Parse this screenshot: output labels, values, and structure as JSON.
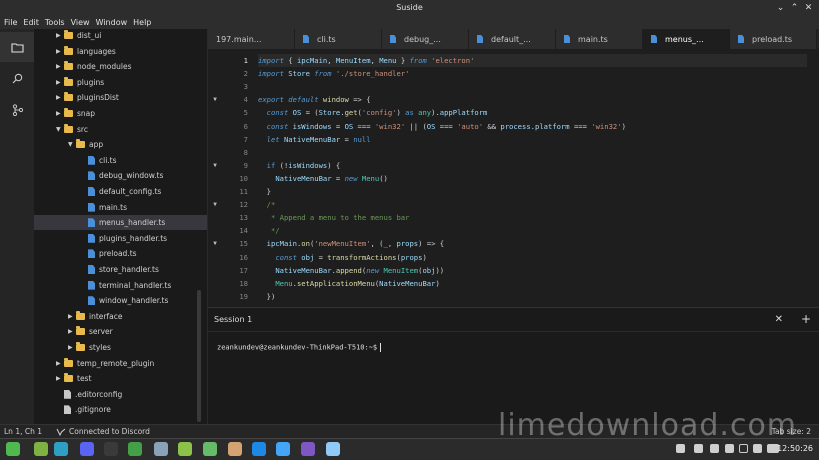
{
  "window": {
    "title": "Suside"
  },
  "menu": [
    "File",
    "Edit",
    "Tools",
    "View",
    "Window",
    "Help"
  ],
  "sidebar": {
    "items": [
      {
        "label": "dist_ui",
        "type": "folder",
        "depth": 1,
        "expanded": false
      },
      {
        "label": "languages",
        "type": "folder",
        "depth": 1,
        "expanded": false
      },
      {
        "label": "node_modules",
        "type": "folder",
        "depth": 1,
        "expanded": false
      },
      {
        "label": "plugins",
        "type": "folder",
        "depth": 1,
        "expanded": false
      },
      {
        "label": "pluginsDist",
        "type": "folder",
        "depth": 1,
        "expanded": false
      },
      {
        "label": "snap",
        "type": "folder",
        "depth": 1,
        "expanded": false
      },
      {
        "label": "src",
        "type": "folder",
        "depth": 1,
        "expanded": true
      },
      {
        "label": "app",
        "type": "folder",
        "depth": 2,
        "expanded": true
      },
      {
        "label": "cli.ts",
        "type": "ts",
        "depth": 3
      },
      {
        "label": "debug_window.ts",
        "type": "ts",
        "depth": 3
      },
      {
        "label": "default_config.ts",
        "type": "ts",
        "depth": 3
      },
      {
        "label": "main.ts",
        "type": "ts",
        "depth": 3
      },
      {
        "label": "menus_handler.ts",
        "type": "ts",
        "depth": 3,
        "selected": true
      },
      {
        "label": "plugins_handler.ts",
        "type": "ts",
        "depth": 3
      },
      {
        "label": "preload.ts",
        "type": "ts",
        "depth": 3
      },
      {
        "label": "store_handler.ts",
        "type": "ts",
        "depth": 3
      },
      {
        "label": "terminal_handler.ts",
        "type": "ts",
        "depth": 3
      },
      {
        "label": "window_handler.ts",
        "type": "ts",
        "depth": 3
      },
      {
        "label": "interface",
        "type": "folder",
        "depth": 2,
        "expanded": false
      },
      {
        "label": "server",
        "type": "folder",
        "depth": 2,
        "expanded": false
      },
      {
        "label": "styles",
        "type": "folder",
        "depth": 2,
        "expanded": false
      },
      {
        "label": "temp_remote_plugin",
        "type": "folder",
        "depth": 1,
        "expanded": false
      },
      {
        "label": "test",
        "type": "folder",
        "depth": 1,
        "expanded": false
      },
      {
        "label": ".editorconfig",
        "type": "file",
        "depth": 1
      },
      {
        "label": ".gitignore",
        "type": "file",
        "depth": 1
      }
    ]
  },
  "tabs": [
    {
      "label": "197.main...",
      "icon": false,
      "active": false
    },
    {
      "label": "cli.ts",
      "icon": true,
      "active": false
    },
    {
      "label": "debug_...",
      "icon": true,
      "active": false
    },
    {
      "label": "default_...",
      "icon": true,
      "active": false
    },
    {
      "label": "main.ts",
      "icon": true,
      "active": false
    },
    {
      "label": "menus_...",
      "icon": true,
      "active": true
    },
    {
      "label": "preload.ts",
      "icon": true,
      "active": false
    }
  ],
  "editor": {
    "lines": [
      {
        "n": "1",
        "fold": "",
        "html": "<span class='kw it'>import</span> { <span class='var'>ipcMain</span>, <span class='var'>MenuItem</span>, <span class='var'>Menu</span> } <span class='kw it'>from</span> <span class='str'>'electron'</span>"
      },
      {
        "n": "2",
        "fold": "",
        "html": "<span class='kw it'>import</span> <span class='var'>Store</span> <span class='kw it'>from</span> <span class='str'>'./store_handler'</span>"
      },
      {
        "n": "3",
        "fold": "",
        "html": ""
      },
      {
        "n": "4",
        "fold": "▼",
        "html": "<span class='kw it'>export default</span> <span class='fn'>window</span> <span class='op'>=&gt;</span> {"
      },
      {
        "n": "5",
        "fold": "",
        "html": "  <span class='kw it'>const</span> <span class='var'>OS</span> = (<span class='var'>Store</span>.<span class='fn'>get</span>(<span class='str'>'config'</span>) <span class='kw'>as</span> <span class='cls'>any</span>).<span class='var'>appPlatform</span>"
      },
      {
        "n": "6",
        "fold": "",
        "html": "  <span class='kw it'>const</span> <span class='var'>isWindows</span> = <span class='var'>OS</span> === <span class='str'>'win32'</span> || (<span class='var'>OS</span> === <span class='str'>'auto'</span> &amp;&amp; <span class='var'>process</span>.<span class='var'>platform</span> === <span class='str'>'win32'</span>)"
      },
      {
        "n": "7",
        "fold": "",
        "html": "  <span class='kw it'>let</span> <span class='var'>NativeMenuBar</span> = <span class='kw'>null</span>"
      },
      {
        "n": "8",
        "fold": "",
        "html": ""
      },
      {
        "n": "9",
        "fold": "▼",
        "html": "  <span class='kw'>if</span> (!<span class='var'>isWindows</span>) {"
      },
      {
        "n": "10",
        "fold": "",
        "html": "    <span class='var'>NativeMenuBar</span> = <span class='kw it'>new</span> <span class='cls'>Menu</span>()"
      },
      {
        "n": "11",
        "fold": "",
        "html": "  }"
      },
      {
        "n": "12",
        "fold": "▼",
        "html": "  <span class='cm'>/*</span>"
      },
      {
        "n": "13",
        "fold": "",
        "html": "   <span class='cm'>* Append a menu to the menus bar</span>"
      },
      {
        "n": "14",
        "fold": "",
        "html": "   <span class='cm'>*/</span>"
      },
      {
        "n": "15",
        "fold": "▼",
        "html": "  <span class='var'>ipcMain</span>.<span class='fn'>on</span>(<span class='str'>'newMenuItem'</span>, (<span class='var'>_</span>, <span class='var'>props</span>) <span class='op'>=&gt;</span> {"
      },
      {
        "n": "16",
        "fold": "",
        "html": "    <span class='kw it'>const</span> <span class='var'>obj</span> = <span class='fn'>transformActions</span>(<span class='var'>props</span>)"
      },
      {
        "n": "17",
        "fold": "",
        "html": "    <span class='var'>NativeMenuBar</span>.<span class='fn'>append</span>(<span class='kw it'>new</span> <span class='cls'>MenuItem</span>(<span class='var'>obj</span>))"
      },
      {
        "n": "18",
        "fold": "",
        "html": "    <span class='cls'>Menu</span>.<span class='fn'>setApplicationMenu</span>(<span class='var'>NativeMenuBar</span>)"
      },
      {
        "n": "19",
        "fold": "",
        "html": "  })"
      }
    ]
  },
  "terminal": {
    "tab_label": "Session 1",
    "close_glyph": "✕",
    "new_glyph": "+",
    "prompt": "zeankundev@zeankundev-ThinkPad-T510:~$"
  },
  "status": {
    "position": "Ln 1, Ch 1",
    "discord": "Connected to Discord",
    "tab_size": "Tab size: 2"
  },
  "watermark": "limedownload.com",
  "taskbar": {
    "clock": "12:50:26",
    "apps": [
      {
        "name": "mint-menu-icon",
        "color": "#4fb84f"
      },
      {
        "name": "files-icon",
        "color": "#7cb342"
      },
      {
        "name": "edge-icon",
        "color": "#2fa0c4"
      },
      {
        "name": "discord-icon",
        "color": "#5865f2"
      },
      {
        "name": "terminal-icon",
        "color": "#3a3a3a"
      },
      {
        "name": "app-green-icon",
        "color": "#43a047"
      },
      {
        "name": "suside-icon",
        "color": "#8aa2b8"
      },
      {
        "name": "folder-icon",
        "color": "#8bc34a"
      },
      {
        "name": "grid-icon",
        "color": "#66bb6a"
      },
      {
        "name": "package-icon",
        "color": "#d4a373"
      },
      {
        "name": "camera-icon",
        "color": "#1e88e5"
      },
      {
        "name": "docs-icon",
        "color": "#42a5f5"
      },
      {
        "name": "calendar-icon",
        "color": "#7e57c2"
      },
      {
        "name": "chat-icon",
        "color": "#90caf9"
      }
    ]
  }
}
